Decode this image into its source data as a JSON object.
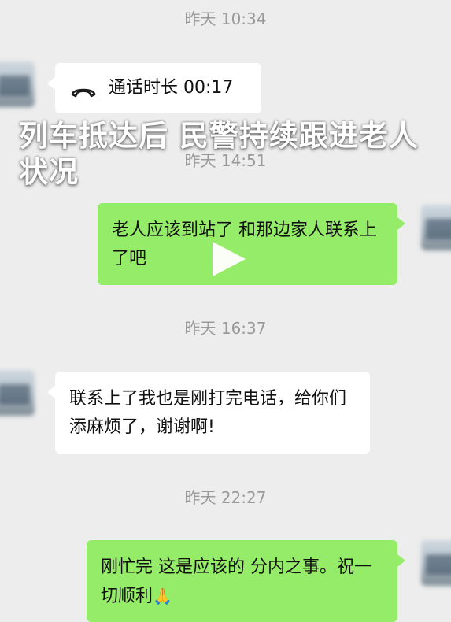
{
  "messages": {
    "ts1": "昨天 10:34",
    "call_text": "通话时长 00:17",
    "ts2": "昨天 14:51",
    "msg1": "老人应该到站了 和那边家人联系上了吧",
    "ts3": "昨天 16:37",
    "msg2": "联系上了我也是刚打完电话，给你们添麻烦了，谢谢啊!",
    "ts4": "昨天 22:27",
    "msg3_line": "刚忙完 这是应该的  分内之事。祝一切顺利",
    "msg3_emoji": "🙏"
  },
  "overlay": {
    "title": "列车抵达后 民警持续跟进老人状况"
  },
  "colors": {
    "background": "#ededed",
    "bubble_green": "#95ec69",
    "bubble_white": "#ffffff",
    "timestamp": "#9a9a9a"
  },
  "icons": {
    "call": "phone-icon",
    "play": "play-icon"
  }
}
